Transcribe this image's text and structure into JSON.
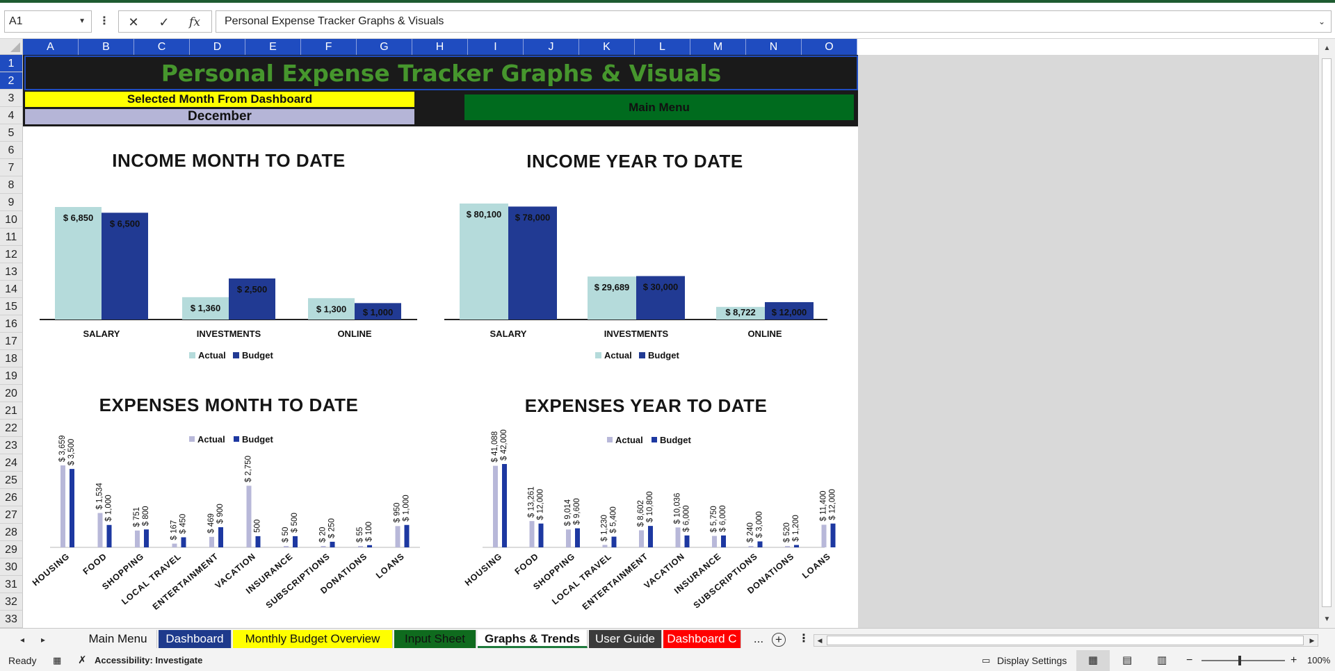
{
  "formula_bar": {
    "name_box": "A1",
    "content": "Personal Expense Tracker Graphs & Visuals",
    "cancel_icon": "✕",
    "enter_icon": "✓",
    "fx_label": "fx"
  },
  "columns": [
    "A",
    "B",
    "C",
    "D",
    "E",
    "F",
    "G",
    "H",
    "I",
    "J",
    "K",
    "L",
    "M",
    "N",
    "O"
  ],
  "rows": [
    "1",
    "2",
    "3",
    "4",
    "5",
    "6",
    "7",
    "8",
    "9",
    "10",
    "11",
    "12",
    "13",
    "14",
    "15",
    "16",
    "17",
    "18",
    "19",
    "20",
    "21",
    "22",
    "23",
    "24",
    "25",
    "26",
    "27",
    "28",
    "29",
    "30",
    "31",
    "32",
    "33"
  ],
  "sheet": {
    "title": "Personal Expense Tracker Graphs & Visuals",
    "selected_month_label": "Selected Month From Dashboard",
    "selected_month_value": "December",
    "main_menu_label": "Main Menu"
  },
  "colors": {
    "actual": "#b5dbdb",
    "budget": "#213a93",
    "actual_expense": "#b8b8d9",
    "budget_expense": "#1d38a1",
    "title_green": "#46962d",
    "column_header": "#1f4cc0"
  },
  "chart_data": [
    {
      "type": "bar",
      "title": "INCOME MONTH TO DATE",
      "categories": [
        "SALARY",
        "INVESTMENTS",
        "ONLINE"
      ],
      "series": [
        {
          "name": "Actual",
          "values": [
            6850,
            1360,
            1300
          ],
          "labels": [
            "$ 6,850",
            "$ 1,360",
            "$ 1,300"
          ]
        },
        {
          "name": "Budget",
          "values": [
            6500,
            2500,
            1000
          ],
          "labels": [
            "$ 6,500",
            "$ 2,500",
            "$ 1,000"
          ]
        }
      ],
      "legend": "bottom"
    },
    {
      "type": "bar",
      "title": "INCOME YEAR TO DATE",
      "categories": [
        "SALARY",
        "INVESTMENTS",
        "ONLINE"
      ],
      "series": [
        {
          "name": "Actual",
          "values": [
            80100,
            29689,
            8722
          ],
          "labels": [
            "$ 80,100",
            "$ 29,689",
            "$ 8,722"
          ]
        },
        {
          "name": "Budget",
          "values": [
            78000,
            30000,
            12000
          ],
          "labels": [
            "$ 78,000",
            "$ 30,000",
            "$ 12,000"
          ]
        }
      ],
      "legend": "bottom"
    },
    {
      "type": "bar",
      "title": "EXPENSES MONTH TO DATE",
      "categories": [
        "HOUSING",
        "FOOD",
        "SHOPPING",
        "LOCAL TRAVEL",
        "ENTERTAINMENT",
        "VACATION",
        "INSURANCE",
        "SUBSCRIPTIONS",
        "DONATIONS",
        "LOANS"
      ],
      "series": [
        {
          "name": "Actual",
          "values": [
            3659,
            1534,
            751,
            167,
            469,
            2750,
            50,
            20,
            55,
            950
          ],
          "labels": [
            "$ 3,659",
            "$ 1,534",
            "$ 751",
            "$ 167",
            "$ 469",
            "$ 2,750",
            "$ 50",
            "$ 20",
            "$ 55",
            "$ 950"
          ]
        },
        {
          "name": "Budget",
          "values": [
            3500,
            1000,
            800,
            450,
            900,
            500,
            500,
            250,
            100,
            1000
          ],
          "labels": [
            "$ 3,500",
            "$ 1,000",
            "$ 800",
            "$ 450",
            "$ 900",
            "500",
            "$ 500",
            "$ 250",
            "$ 100",
            "$ 1,000"
          ]
        }
      ],
      "legend": "top"
    },
    {
      "type": "bar",
      "title": "EXPENSES YEAR TO DATE",
      "categories": [
        "HOUSING",
        "FOOD",
        "SHOPPING",
        "LOCAL TRAVEL",
        "ENTERTAINMENT",
        "VACATION",
        "INSURANCE",
        "SUBSCRIPTIONS",
        "DONATIONS",
        "LOANS"
      ],
      "series": [
        {
          "name": "Actual",
          "values": [
            41088,
            13261,
            9014,
            1230,
            8602,
            10036,
            5750,
            240,
            520,
            11400
          ],
          "labels": [
            "$ 41,088",
            "$ 13,261",
            "$ 9,014",
            "$ 1,230",
            "$ 8,602",
            "$ 10,036",
            "$ 5,750",
            "$ 240",
            "$ 520",
            "$ 11,400"
          ]
        },
        {
          "name": "Budget",
          "values": [
            42000,
            12000,
            9600,
            5400,
            10800,
            6000,
            6000,
            3000,
            1200,
            12000
          ],
          "labels": [
            "$ 42,000",
            "$ 12,000",
            "$ 9,600",
            "$ 5,400",
            "$ 10,800",
            "$ 6,000",
            "$ 6,000",
            "$ 3,000",
            "$ 1,200",
            "$ 12,000"
          ]
        }
      ],
      "legend": "top"
    }
  ],
  "tabs": [
    {
      "label": "Main Menu",
      "bg": "#f3f3f3",
      "fg": "#111111"
    },
    {
      "label": "Dashboard",
      "bg": "#1e3a8c",
      "fg": "#ffffff"
    },
    {
      "label": "Monthly Budget Overview",
      "bg": "#ffff00",
      "fg": "#111111"
    },
    {
      "label": "Input Sheet",
      "bg": "#0f6b1e",
      "fg": "#111111"
    },
    {
      "label": "Graphs & Trends",
      "bg": "#ffffff",
      "fg": "#111111",
      "active": true
    },
    {
      "label": "User Guide",
      "bg": "#3b3b3b",
      "fg": "#ffffff"
    },
    {
      "label": "Dashboard C",
      "bg": "#ff0000",
      "fg": "#ffffff"
    }
  ],
  "tab_ellipsis": "...",
  "status_bar": {
    "ready": "Ready",
    "accessibility": "Accessibility: Investigate",
    "display_settings": "Display Settings",
    "zoom": "100%"
  }
}
